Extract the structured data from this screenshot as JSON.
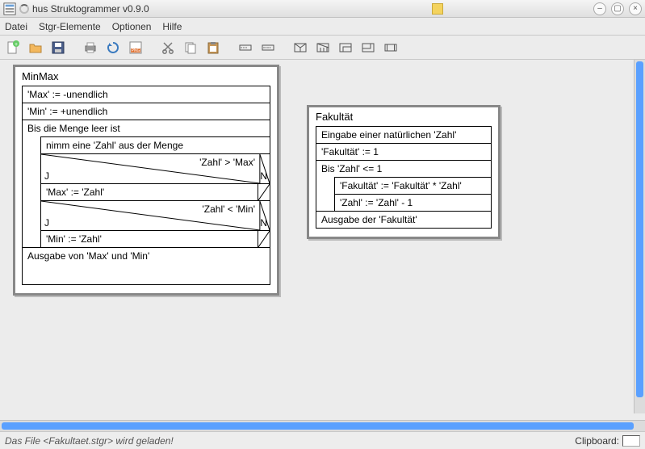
{
  "window": {
    "title": "hus Struktogrammer v0.9.0"
  },
  "menu": {
    "datei": "Datei",
    "stgr": "Stgr-Elemente",
    "optionen": "Optionen",
    "hilfe": "Hilfe"
  },
  "status": {
    "msg": "Das File <Fakultaet.stgr> wird geladen!",
    "clipboard_label": "Clipboard:"
  },
  "labels": {
    "J": "J",
    "N": "N"
  },
  "struct1": {
    "name": "MinMax",
    "init1": "'Max' := -unendlich",
    "init2": "'Min' := +unendlich",
    "loop_head": "Bis die Menge leer ist",
    "pick": "nimm eine 'Zahl' aus der Menge",
    "cond1": "'Zahl' > 'Max'",
    "assign1": "'Max' := 'Zahl'",
    "cond2": "'Zahl' < 'Min'",
    "assign2": "'Min' := 'Zahl'",
    "output": "Ausgabe von 'Max' und 'Min'"
  },
  "struct2": {
    "name": "Fakultät",
    "input": "Eingabe einer natürlichen 'Zahl'",
    "init": "'Fakultät' := 1",
    "loop_head": "Bis 'Zahl' <= 1",
    "body1": "'Fakultät' := 'Fakultät' * 'Zahl'",
    "body2": "'Zahl' := 'Zahl' - 1",
    "output": "Ausgabe der 'Fakultät'"
  }
}
